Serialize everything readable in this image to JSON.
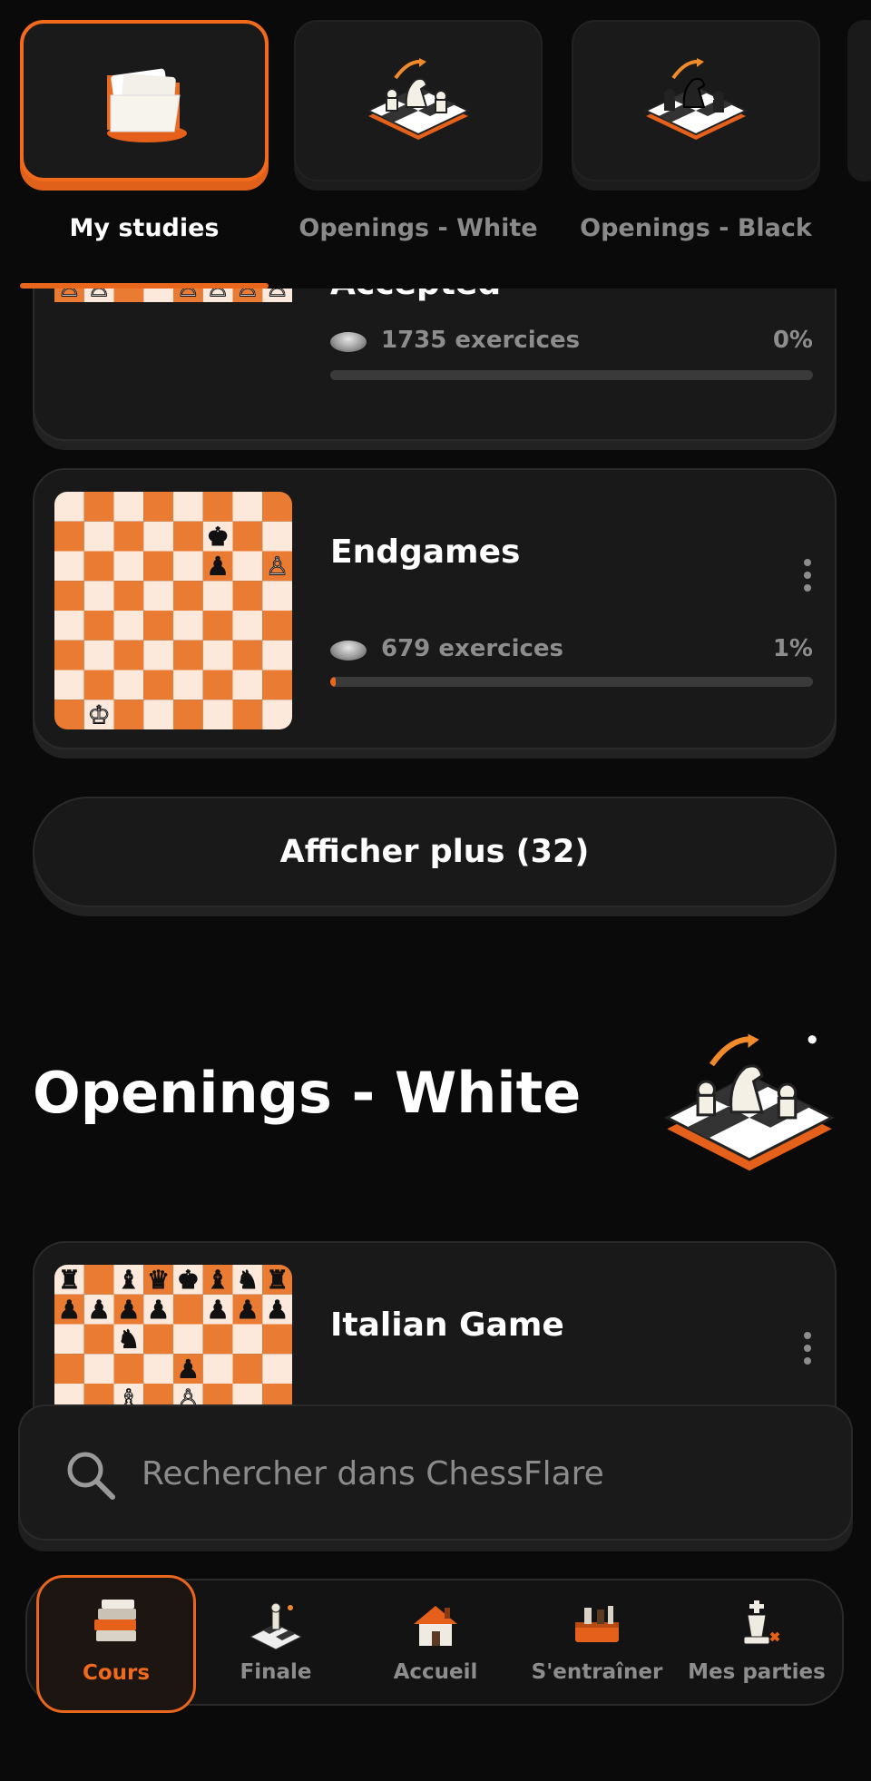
{
  "tabs": [
    {
      "label": "My studies",
      "icon": "folder-icon",
      "active": true
    },
    {
      "label": "Openings - White",
      "icon": "white-opening-board-icon",
      "active": false
    },
    {
      "label": "Openings - Black",
      "icon": "black-opening-board-icon",
      "active": false
    }
  ],
  "studies": [
    {
      "title": "Accepted",
      "count": "1735 exercices",
      "percent": "0%",
      "progress": 0.0
    },
    {
      "title": "Endgames",
      "count": "679 exercices",
      "percent": "1%",
      "progress": 0.01
    }
  ],
  "show_more_label": "Afficher plus (32)",
  "section": {
    "title": "Openings - White",
    "icon": "white-opening-board-icon"
  },
  "section_studies": [
    {
      "title": "Italian Game"
    }
  ],
  "search": {
    "placeholder": "Rechercher dans ChessFlare"
  },
  "bottom_nav": [
    {
      "label": "Cours",
      "icon": "books-icon",
      "active": true
    },
    {
      "label": "Finale",
      "icon": "finale-board-icon",
      "active": false
    },
    {
      "label": "Accueil",
      "icon": "house-icon",
      "active": false
    },
    {
      "label": "S'entraîner",
      "icon": "toolbox-icon",
      "active": false
    },
    {
      "label": "Mes parties",
      "icon": "king-icon",
      "active": false
    }
  ],
  "colors": {
    "accent": "#e9661d",
    "board_dark": "#e8742a",
    "board_light": "#fde9dc",
    "card_bg": "#1a1919"
  }
}
